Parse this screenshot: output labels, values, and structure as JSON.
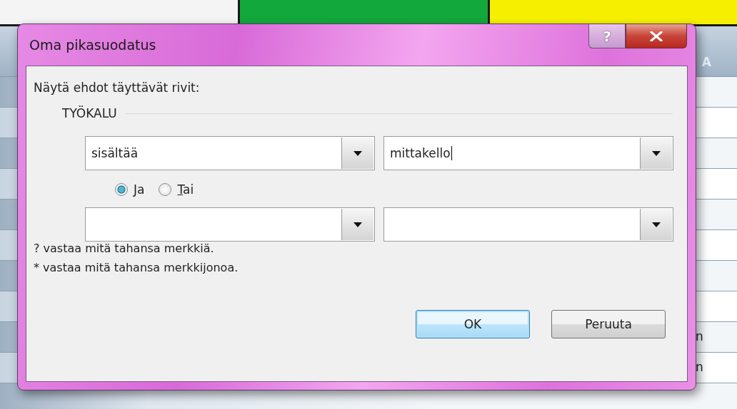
{
  "spreadsheet": {
    "top_cells": [
      {
        "color": "#f4f4f4"
      },
      {
        "color": "#12a83c"
      },
      {
        "color": "#f6f000"
      }
    ],
    "header_fragment": "A",
    "cell_fragments": [
      "n",
      "n"
    ]
  },
  "dialog": {
    "title": "Oma pikasuodatus",
    "help_glyph": "?",
    "prompt": "Näytä ehdot täyttävät rivit:",
    "field_label": "TYÖKALU",
    "criteria": [
      {
        "operator": "sisältää",
        "value": "mittakello",
        "focused": true
      },
      {
        "focused": false
      }
    ],
    "radios": [
      {
        "label": "Ja",
        "selected": true
      },
      {
        "label": "Tai",
        "selected": false
      }
    ],
    "hints": [
      "? vastaa mitä tahansa merkkiä.",
      "* vastaa mitä tahansa merkkijonoa."
    ],
    "buttons": [
      {
        "label": "OK",
        "default": true
      },
      {
        "label": "Peruuta",
        "default": false
      }
    ]
  }
}
